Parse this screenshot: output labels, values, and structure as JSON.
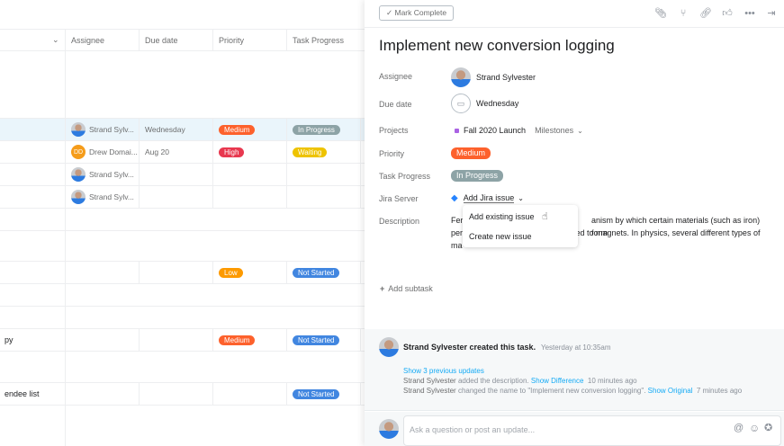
{
  "list": {
    "columns": [
      "Assignee",
      "Due date",
      "Priority",
      "Task Progress"
    ],
    "rows": [
      {
        "name": "",
        "assignee": "Strand Sylv...",
        "due": "Wednesday",
        "priority": "Medium",
        "progress": "In Progress"
      },
      {
        "name": "",
        "assignee": "Drew Domai...",
        "assignee_initials": "DD",
        "due": "Aug 20",
        "priority": "High",
        "progress": "Waiting"
      },
      {
        "name": "",
        "assignee": "Strand Sylv..."
      },
      {
        "name": "",
        "assignee": "Strand Sylv..."
      },
      {
        "name": "",
        "priority": "Low",
        "progress": "Not Started"
      },
      {
        "name": "py",
        "priority": "Medium",
        "progress": "Not Started"
      },
      {
        "name": "endee list",
        "progress": "Not Started"
      }
    ]
  },
  "colors": {
    "medium": "#fd612c",
    "high": "#e8384f",
    "low": "#fd9a00",
    "in_progress": "#8da3a6",
    "waiting": "#eec300",
    "not_started": "#4186e0",
    "project": "#aa62e3",
    "jira": "#2684ff"
  },
  "panel": {
    "mark_complete": "✓ Mark Complete",
    "title": "Implement new conversion logging",
    "labels": {
      "assignee": "Assignee",
      "due": "Due date",
      "projects": "Projects",
      "priority": "Priority",
      "progress": "Task Progress",
      "jira": "Jira Server",
      "description": "Description"
    },
    "assignee": "Strand Sylvester",
    "due": "Wednesday",
    "project": "Fall 2020 Launch",
    "milestones": "Milestones",
    "priority": "Medium",
    "progress": "In Progress",
    "jira": "Add Jira issue",
    "desc_lines": [
      "Fer",
      "anism by which certain materials (such as iron) form",
      "per",
      "ted to magnets. In physics, several different types of",
      "ma"
    ],
    "dropdown": [
      "Add existing issue",
      "Create new issue"
    ],
    "add_subtask": "Add subtask"
  },
  "activity": {
    "creator": "Strand Sylvester created this task.",
    "created_time": "Yesterday at 10:35am",
    "show_prev": "Show 3 previous updates",
    "u1_user": "Strand Sylvester",
    "u1_text": "added the description.",
    "u1_link": "Show Difference",
    "u1_time": "10 minutes ago",
    "u2_user": "Strand Sylvester",
    "u2_text": "changed the name to \"Implement new conversion logging\".",
    "u2_link": "Show Original",
    "u2_time": "7 minutes ago",
    "comment_placeholder": "Ask a question or post an update..."
  }
}
